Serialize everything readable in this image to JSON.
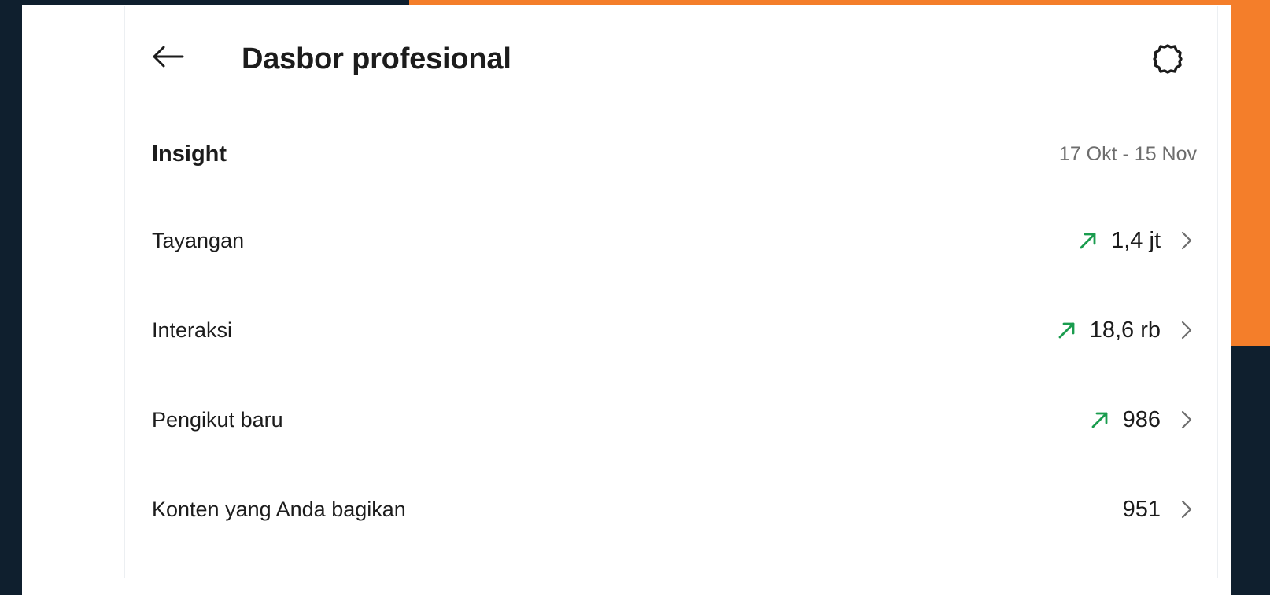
{
  "header": {
    "title": "Dasbor profesional",
    "back_icon": "arrow-left-icon",
    "settings_icon": "gear-icon"
  },
  "insight": {
    "title": "Insight",
    "date_range": "17 Okt - 15 Nov",
    "rows": [
      {
        "label": "Tayangan",
        "value": "1,4 jt",
        "trend": "up"
      },
      {
        "label": "Interaksi",
        "value": "18,6 rb",
        "trend": "up"
      },
      {
        "label": "Pengikut baru",
        "value": "986",
        "trend": "up"
      },
      {
        "label": "Konten yang Anda bagikan",
        "value": "951",
        "trend": "none"
      }
    ]
  },
  "colors": {
    "trend_up": "#1a9c4e",
    "text": "#1c1c1c",
    "muted": "#6d6d6d",
    "accent": "#f47e2a",
    "backdrop": "#0f1f2e"
  }
}
